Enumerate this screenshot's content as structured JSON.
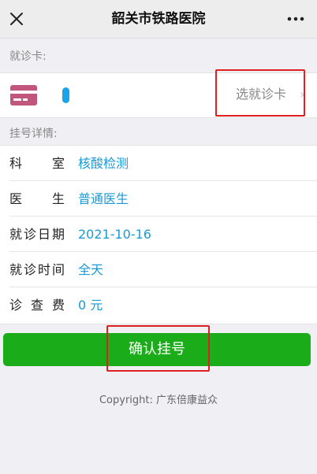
{
  "nav": {
    "title": "韶关市铁路医院",
    "close_icon": "close-icon",
    "more_icon": "more-icon"
  },
  "card_section": {
    "label": "就诊卡:",
    "select_label": "选就诊卡",
    "chevron": "›",
    "card_icon": "card-icon",
    "accent": "#c2557b"
  },
  "details_section": {
    "label": "挂号详情:",
    "rows": [
      {
        "label": "科室",
        "value": "核酸检测"
      },
      {
        "label": "医生",
        "value": "普通医生"
      },
      {
        "label": "就诊日期",
        "value": "2021-10-16"
      },
      {
        "label": "就诊时间",
        "value": "全天"
      },
      {
        "label": "诊查费",
        "value": "0 元"
      }
    ]
  },
  "confirm_button": {
    "label": "确认挂号",
    "color": "#1aad19"
  },
  "footer": {
    "copyright": "Copyright: 广东倍康益众"
  }
}
